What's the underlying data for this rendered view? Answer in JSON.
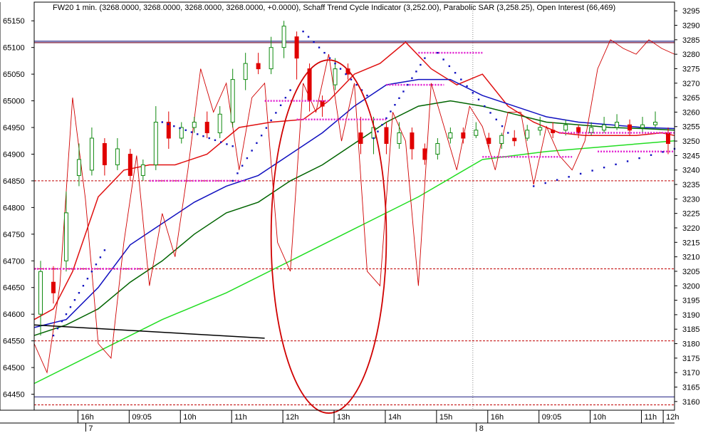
{
  "chart_data": {
    "type": "line",
    "title": "FW20 1 min. (3268.0000, 3268.0000, 3268.0000, 3268.0000, +0.0000), Schaff Trend Cycle Indicator (3,252.00), Parabolic SAR (3,258.25), Open Interest (66,469)",
    "left_axis": {
      "ticks": [
        "65150",
        "65100",
        "65050",
        "65000",
        "64950",
        "64900",
        "64850",
        "64800",
        "64750",
        "64700",
        "64650",
        "64600",
        "64550",
        "64500",
        "64450"
      ],
      "range": [
        64420,
        65185
      ]
    },
    "right_axis": {
      "ticks": [
        "3295",
        "3290",
        "3285",
        "3280",
        "3275",
        "3270",
        "3265",
        "3260",
        "3255",
        "3250",
        "3245",
        "3240",
        "3235",
        "3230",
        "3225",
        "3220",
        "3215",
        "3210",
        "3205",
        "3200",
        "3195",
        "3190",
        "3185",
        "3180",
        "3175",
        "3170",
        "3165",
        "3160"
      ],
      "range": [
        3157,
        3298
      ]
    },
    "time_ticks": [
      "16h",
      "09:05",
      "10h",
      "11h",
      "12h",
      "13h",
      "14h",
      "15h",
      "16h",
      "09:05",
      "10h",
      "11h",
      "12h"
    ],
    "day_labels": [
      "7",
      "8"
    ],
    "x_range": [
      0,
      100
    ],
    "series": [
      {
        "color": "#e01010",
        "axis": "left",
        "x": [
          0,
          3,
          6,
          10,
          14,
          18,
          22,
          27,
          32,
          37,
          42,
          46,
          50,
          54,
          58,
          62,
          66,
          70,
          74,
          78,
          82,
          86,
          90,
          94,
          98,
          100
        ],
        "values": [
          64590,
          64610,
          64680,
          64820,
          64870,
          64880,
          64880,
          64900,
          64950,
          64960,
          64965,
          65000,
          65050,
          65070,
          65110,
          65060,
          65030,
          65050,
          64990,
          64960,
          64940,
          64935,
          64935,
          64935,
          64940,
          64935
        ]
      },
      {
        "color": "#1010c0",
        "axis": "left",
        "x": [
          0,
          5,
          10,
          15,
          20,
          25,
          30,
          35,
          40,
          45,
          50,
          55,
          60,
          65,
          70,
          75,
          80,
          85,
          90,
          95,
          100
        ],
        "values": [
          64575,
          64590,
          64650,
          64730,
          64770,
          64810,
          64840,
          64860,
          64900,
          64940,
          64990,
          65030,
          65040,
          65040,
          65010,
          64990,
          64970,
          64960,
          64955,
          64950,
          64948
        ]
      },
      {
        "color": "#006400",
        "axis": "left",
        "x": [
          0,
          5,
          10,
          15,
          20,
          25,
          30,
          35,
          40,
          45,
          50,
          55,
          60,
          65,
          70,
          75,
          80,
          85,
          90,
          95,
          100
        ],
        "values": [
          64560,
          64580,
          64610,
          64660,
          64700,
          64750,
          64790,
          64810,
          64850,
          64880,
          64920,
          64960,
          64990,
          65000,
          64990,
          64975,
          64960,
          64955,
          64950,
          64948,
          64945
        ]
      },
      {
        "color": "#22dd22",
        "axis": "left",
        "x": [
          0,
          10,
          20,
          30,
          40,
          50,
          60,
          70,
          80,
          90,
          100
        ],
        "values": [
          64470,
          64530,
          64590,
          64640,
          64700,
          64760,
          64820,
          64890,
          64905,
          64915,
          64925
        ]
      },
      {
        "color": "#d00000",
        "axis": "right",
        "x": [
          0,
          2,
          4,
          6,
          8,
          10,
          12,
          14,
          16,
          18,
          20,
          22,
          24,
          26,
          28,
          30,
          32,
          34,
          36,
          38,
          40,
          42,
          44,
          46,
          48,
          50,
          52,
          54,
          56,
          58,
          60,
          62,
          64,
          66,
          68,
          70,
          72,
          74,
          76,
          78,
          80,
          82,
          84,
          86,
          88,
          90,
          92,
          94,
          96,
          98,
          100
        ],
        "values": [
          3180,
          3170,
          3200,
          3265,
          3230,
          3180,
          3175,
          3215,
          3245,
          3200,
          3225,
          3210,
          3240,
          3275,
          3260,
          3270,
          3240,
          3265,
          3270,
          3215,
          3205,
          3270,
          3260,
          3280,
          3250,
          3270,
          3205,
          3200,
          3260,
          3250,
          3200,
          3270,
          3255,
          3240,
          3262,
          3255,
          3240,
          3260,
          3260,
          3235,
          3255,
          3245,
          3240,
          3250,
          3275,
          3285,
          3282,
          3280,
          3285,
          3282,
          3280
        ]
      },
      {
        "color": "#000000",
        "axis": "left",
        "x": [
          0,
          36
        ],
        "values": [
          64580,
          64555
        ]
      }
    ],
    "candles": [
      {
        "x": 1,
        "open": 64600,
        "close": 64680,
        "high": 64700,
        "low": 64560
      },
      {
        "x": 3,
        "open": 64660,
        "close": 64640,
        "high": 64690,
        "low": 64620
      },
      {
        "x": 5,
        "open": 64700,
        "close": 64790,
        "high": 64830,
        "low": 64680
      },
      {
        "x": 7,
        "open": 64860,
        "close": 64890,
        "high": 64920,
        "low": 64840
      },
      {
        "x": 9,
        "open": 64870,
        "close": 64930,
        "high": 64950,
        "low": 64860
      },
      {
        "x": 11,
        "open": 64920,
        "close": 64880,
        "high": 64930,
        "low": 64860
      },
      {
        "x": 13,
        "open": 64880,
        "close": 64910,
        "high": 64930,
        "low": 64870
      },
      {
        "x": 15,
        "open": 64900,
        "close": 64860,
        "high": 64910,
        "low": 64850
      },
      {
        "x": 17,
        "open": 64860,
        "close": 64880,
        "high": 64890,
        "low": 64850
      },
      {
        "x": 19,
        "open": 64880,
        "close": 64960,
        "high": 64990,
        "low": 64870
      },
      {
        "x": 21,
        "open": 64960,
        "close": 64930,
        "high": 64980,
        "low": 64910
      },
      {
        "x": 23,
        "open": 64930,
        "close": 64950,
        "high": 64960,
        "low": 64920
      },
      {
        "x": 25,
        "open": 64950,
        "close": 64960,
        "high": 64970,
        "low": 64940
      },
      {
        "x": 27,
        "open": 64960,
        "close": 64940,
        "high": 64980,
        "low": 64930
      },
      {
        "x": 29,
        "open": 64940,
        "close": 64975,
        "high": 64990,
        "low": 64930
      },
      {
        "x": 31,
        "open": 64960,
        "close": 65040,
        "high": 65060,
        "low": 64950
      },
      {
        "x": 33,
        "open": 65040,
        "close": 65070,
        "high": 65090,
        "low": 65020
      },
      {
        "x": 35,
        "open": 65070,
        "close": 65060,
        "high": 65090,
        "low": 65050
      },
      {
        "x": 37,
        "open": 65060,
        "close": 65100,
        "high": 65120,
        "low": 65050
      },
      {
        "x": 39,
        "open": 65100,
        "close": 65140,
        "high": 65150,
        "low": 65080
      },
      {
        "x": 41,
        "open": 65120,
        "close": 65080,
        "high": 65130,
        "low": 65040
      },
      {
        "x": 43,
        "open": 65060,
        "close": 65000,
        "high": 65070,
        "low": 64980
      },
      {
        "x": 45,
        "open": 65000,
        "close": 64990,
        "high": 65010,
        "low": 64970
      },
      {
        "x": 47,
        "open": 65030,
        "close": 65060,
        "high": 65080,
        "low": 65020
      },
      {
        "x": 49,
        "open": 65060,
        "close": 65050,
        "high": 65070,
        "low": 65040
      },
      {
        "x": 51,
        "open": 64940,
        "close": 64920,
        "high": 64970,
        "low": 64900
      },
      {
        "x": 53,
        "open": 64930,
        "close": 64950,
        "high": 64970,
        "low": 64900
      },
      {
        "x": 55,
        "open": 64950,
        "close": 64920,
        "high": 64960,
        "low": 64900
      },
      {
        "x": 57,
        "open": 64920,
        "close": 64940,
        "high": 64960,
        "low": 64910
      },
      {
        "x": 59,
        "open": 64940,
        "close": 64910,
        "high": 64950,
        "low": 64890
      },
      {
        "x": 61,
        "open": 64910,
        "close": 64890,
        "high": 64920,
        "low": 64880
      },
      {
        "x": 63,
        "open": 64900,
        "close": 64920,
        "high": 64930,
        "low": 64890
      },
      {
        "x": 65,
        "open": 64930,
        "close": 64940,
        "high": 64950,
        "low": 64920
      },
      {
        "x": 67,
        "open": 64940,
        "close": 64930,
        "high": 64950,
        "low": 64920
      },
      {
        "x": 69,
        "open": 64935,
        "close": 64945,
        "high": 64960,
        "low": 64930
      },
      {
        "x": 71,
        "open": 64930,
        "close": 64920,
        "high": 64940,
        "low": 64910
      },
      {
        "x": 73,
        "open": 64920,
        "close": 64935,
        "high": 64940,
        "low": 64910
      },
      {
        "x": 75,
        "open": 64930,
        "close": 64925,
        "high": 64945,
        "low": 64915
      },
      {
        "x": 77,
        "open": 64930,
        "close": 64945,
        "high": 64955,
        "low": 64925
      },
      {
        "x": 79,
        "open": 64945,
        "close": 64950,
        "high": 64970,
        "low": 64935
      },
      {
        "x": 81,
        "open": 64945,
        "close": 64940,
        "high": 64960,
        "low": 64930
      },
      {
        "x": 83,
        "open": 64945,
        "close": 64955,
        "high": 64965,
        "low": 64935
      },
      {
        "x": 85,
        "open": 64950,
        "close": 64940,
        "high": 64955,
        "low": 64930
      },
      {
        "x": 87,
        "open": 64940,
        "close": 64950,
        "high": 64960,
        "low": 64935
      },
      {
        "x": 89,
        "open": 64945,
        "close": 64955,
        "high": 64970,
        "low": 64940
      },
      {
        "x": 91,
        "open": 64950,
        "close": 64960,
        "high": 64975,
        "low": 64945
      },
      {
        "x": 93,
        "open": 64955,
        "close": 64945,
        "high": 64965,
        "low": 64935
      },
      {
        "x": 95,
        "open": 64950,
        "close": 64955,
        "high": 64970,
        "low": 64940
      },
      {
        "x": 97,
        "open": 64955,
        "close": 64960,
        "high": 64980,
        "low": 64950
      },
      {
        "x": 99,
        "open": 64940,
        "close": 64920,
        "high": 64950,
        "low": 64900
      }
    ],
    "sar_segments": [
      {
        "x": [
          3,
          11
        ],
        "values": [
          64560,
          64720
        ]
      },
      {
        "x": [
          20,
          31
        ],
        "values": [
          64960,
          64915
        ]
      },
      {
        "x": [
          31,
          40
        ],
        "values": [
          64850,
          65020
        ]
      },
      {
        "x": [
          42,
          52
        ],
        "values": [
          65130,
          65010
        ]
      },
      {
        "x": [
          53,
          61
        ],
        "values": [
          64930,
          65080
        ]
      },
      {
        "x": [
          63,
          74
        ],
        "values": [
          65090,
          64940
        ]
      },
      {
        "x": [
          78,
          100
        ],
        "values": [
          64840,
          64910
        ]
      }
    ],
    "level_marks": [
      {
        "x": [
          0,
          17
        ],
        "value": 64685
      },
      {
        "x": [
          18,
          33
        ],
        "value": 64850
      },
      {
        "x": [
          36,
          46
        ],
        "value": 65000
      },
      {
        "x": [
          41,
          55
        ],
        "value": 64965
      },
      {
        "x": [
          55,
          64
        ],
        "value": 65030
      },
      {
        "x": [
          60,
          70
        ],
        "value": 65090
      },
      {
        "x": [
          70,
          84
        ],
        "value": 64895
      },
      {
        "x": [
          82,
          100
        ],
        "value": 64940
      },
      {
        "x": [
          88,
          100
        ],
        "value": 64905
      }
    ],
    "red_hlines": [
      64850,
      64685,
      64550,
      64430
    ],
    "navy_hlines": [
      64445
    ],
    "top_lines_right": [
      3284,
      3284.5
    ],
    "ellipse": {
      "cx": 46,
      "cy": 3217,
      "rx_pct": 9,
      "ry": 61
    }
  }
}
